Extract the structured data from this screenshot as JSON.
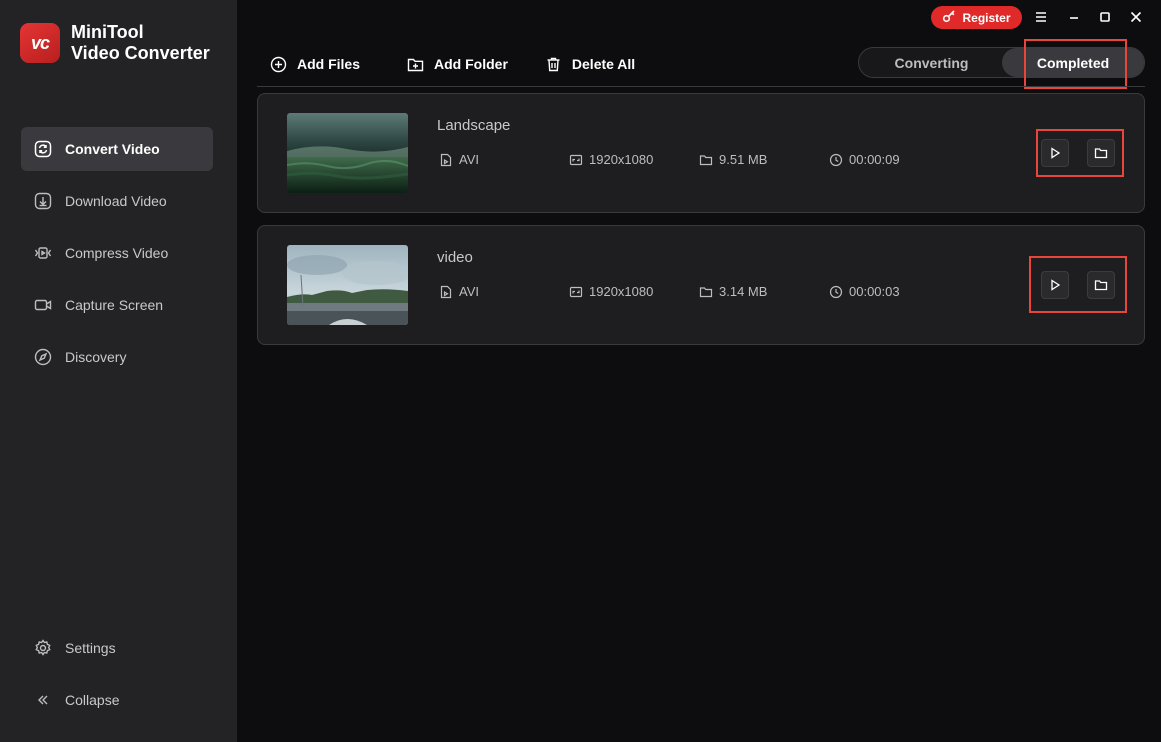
{
  "app": {
    "logo_text": "vc",
    "name_line1": "MiniTool",
    "name_line2": "Video Converter"
  },
  "titlebar": {
    "register_label": "Register"
  },
  "sidebar": {
    "items": [
      {
        "label": "Convert Video",
        "icon": "convert-icon",
        "active": true
      },
      {
        "label": "Download Video",
        "icon": "download-icon"
      },
      {
        "label": "Compress Video",
        "icon": "compress-icon"
      },
      {
        "label": "Capture Screen",
        "icon": "camera-icon"
      },
      {
        "label": "Discovery",
        "icon": "compass-icon"
      }
    ],
    "bottom": [
      {
        "label": "Settings",
        "icon": "gear-icon"
      },
      {
        "label": "Collapse",
        "icon": "collapse-icon"
      }
    ]
  },
  "toolbar": {
    "add_files": "Add Files",
    "add_folder": "Add Folder",
    "delete_all": "Delete All"
  },
  "tabs": {
    "converting": "Converting",
    "completed": "Completed",
    "selected": "Completed"
  },
  "files": [
    {
      "title": "Landscape",
      "format": "AVI",
      "resolution": "1920x1080",
      "size": "9.51 MB",
      "duration": "00:00:09"
    },
    {
      "title": "video",
      "format": "AVI",
      "resolution": "1920x1080",
      "size": "3.14 MB",
      "duration": "00:00:03"
    }
  ],
  "colors": {
    "accent": "#e02a2a",
    "highlight_box": "#e8453b",
    "sidebar_bg": "#232326",
    "main_bg": "#0d0d0f"
  }
}
